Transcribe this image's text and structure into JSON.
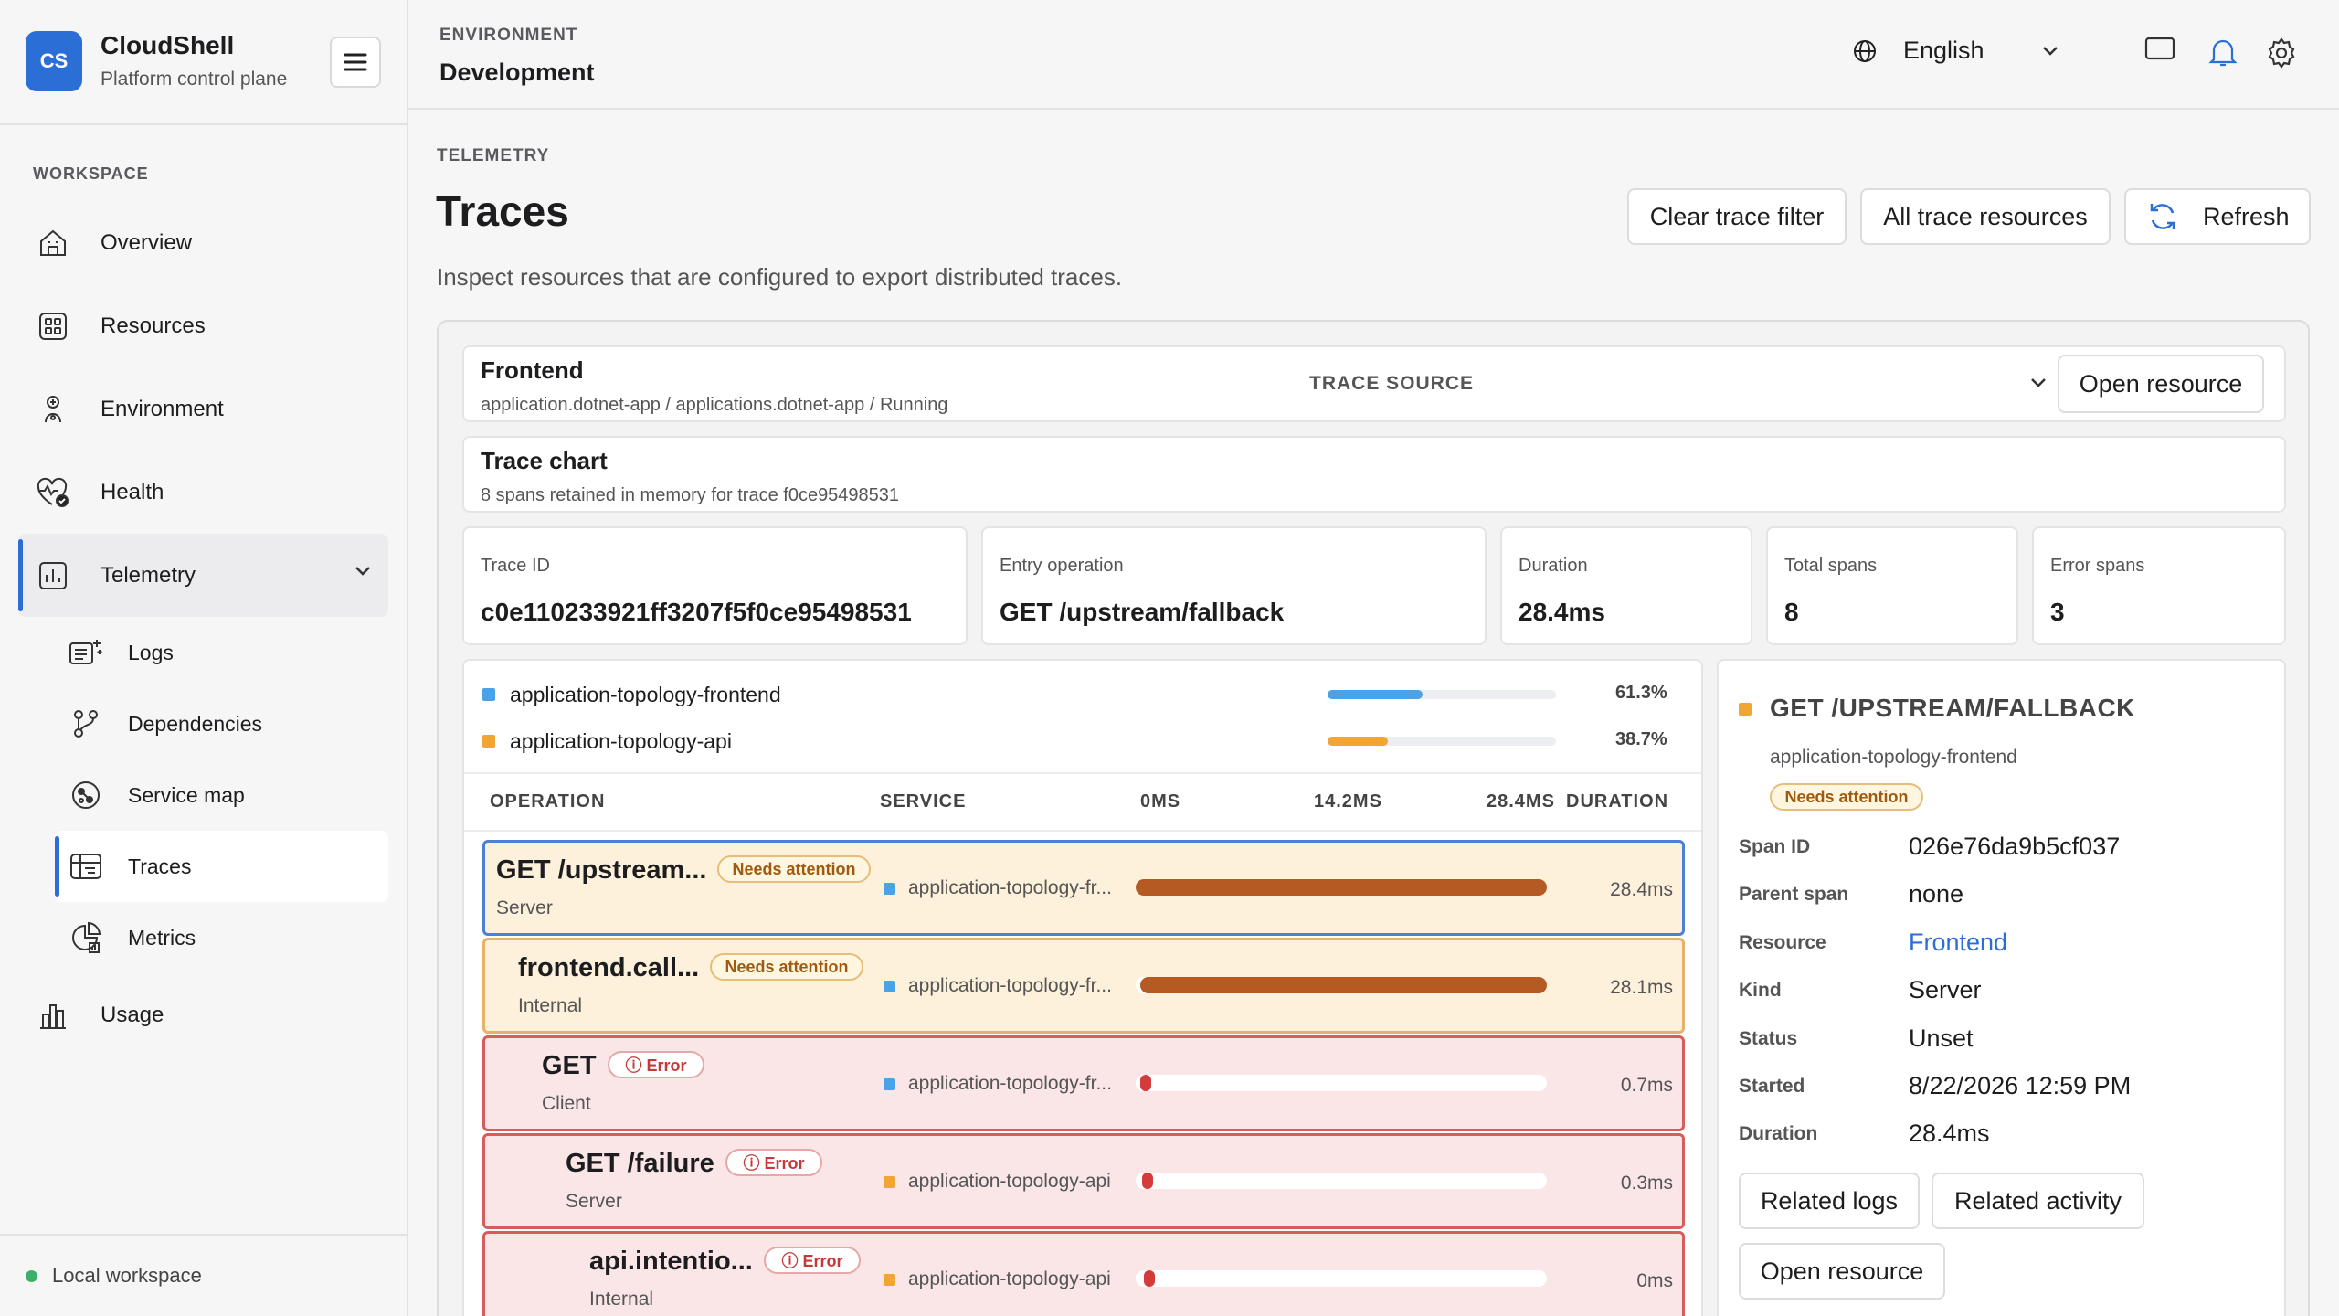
{
  "brand": {
    "logo": "CS",
    "name": "CloudShell",
    "subtitle": "Platform control plane"
  },
  "sidebar": {
    "section_label": "WORKSPACE",
    "items": [
      {
        "label": "Overview",
        "icon": "home-icon"
      },
      {
        "label": "Resources",
        "icon": "grid-icon"
      },
      {
        "label": "Environment",
        "icon": "environment-icon"
      },
      {
        "label": "Health",
        "icon": "heartbeat-icon"
      },
      {
        "label": "Telemetry",
        "icon": "chart-icon",
        "expanded": true
      }
    ],
    "telemetry_children": [
      {
        "label": "Logs",
        "icon": "logs-icon"
      },
      {
        "label": "Dependencies",
        "icon": "dependencies-icon"
      },
      {
        "label": "Service map",
        "icon": "service-map-icon"
      },
      {
        "label": "Traces",
        "icon": "traces-icon",
        "active": true
      },
      {
        "label": "Metrics",
        "icon": "metrics-icon"
      }
    ],
    "usage": {
      "label": "Usage",
      "icon": "usage-icon"
    },
    "footer": "Local workspace"
  },
  "header": {
    "env_label": "ENVIRONMENT",
    "env_value": "Development",
    "language": "English"
  },
  "page": {
    "section_label": "TELEMETRY",
    "title": "Traces",
    "description": "Inspect resources that are configured to export distributed traces.",
    "buttons": {
      "clear": "Clear trace filter",
      "all": "All trace resources",
      "refresh": "Refresh"
    }
  },
  "resource": {
    "name": "Frontend",
    "path": "application.dotnet-app / applications.dotnet-app / Running",
    "trace_source_label": "TRACE SOURCE",
    "open_label": "Open resource"
  },
  "trace_chart": {
    "title": "Trace chart",
    "subtitle": "8 spans retained in memory for trace f0ce95498531"
  },
  "stats": [
    {
      "label": "Trace ID",
      "value": "c0e110233921ff3207f5f0ce95498531"
    },
    {
      "label": "Entry operation",
      "value": "GET /upstream/fallback"
    },
    {
      "label": "Duration",
      "value": "28.4ms"
    },
    {
      "label": "Total spans",
      "value": "8"
    },
    {
      "label": "Error spans",
      "value": "3"
    }
  ],
  "services": [
    {
      "name": "application-topology-frontend",
      "pct_label": "61.3%",
      "share": 0.613,
      "color": "#4aa3e8"
    },
    {
      "name": "application-topology-api",
      "pct_label": "38.7%",
      "share": 0.387,
      "color": "#f0a534"
    }
  ],
  "table": {
    "headers": {
      "operation": "OPERATION",
      "service": "SERVICE",
      "t0": "0MS",
      "t1": "14.2MS",
      "t2": "28.4MS",
      "duration": "DURATION"
    },
    "rows": [
      {
        "op": "GET /upstream...",
        "kind": "Server",
        "badge": "Needs attention",
        "badge_type": "warn",
        "service": "application-topology-fr...",
        "svc_color": "#4aa3e8",
        "start": 0.0,
        "end": 1.0,
        "duration": "28.4ms",
        "indent": 0,
        "status": "selected"
      },
      {
        "op": "frontend.call...",
        "kind": "Internal",
        "badge": "Needs attention",
        "badge_type": "warn",
        "service": "application-topology-fr...",
        "svc_color": "#4aa3e8",
        "start": 0.01,
        "end": 1.0,
        "duration": "28.1ms",
        "indent": 1,
        "status": "warn"
      },
      {
        "op": "GET",
        "kind": "Client",
        "badge": "Error",
        "badge_type": "err",
        "service": "application-topology-fr...",
        "svc_color": "#4aa3e8",
        "start": 0.01,
        "end": 0.035,
        "duration": "0.7ms",
        "indent": 2,
        "status": "err"
      },
      {
        "op": "GET /failure",
        "kind": "Server",
        "badge": "Error",
        "badge_type": "err",
        "service": "application-topology-api",
        "svc_color": "#f0a534",
        "start": 0.015,
        "end": 0.027,
        "duration": "0.3ms",
        "indent": 3,
        "status": "err"
      },
      {
        "op": "api.intentio...",
        "kind": "Internal",
        "badge": "Error",
        "badge_type": "err",
        "service": "application-topology-api",
        "svc_color": "#f0a534",
        "start": 0.02,
        "end": 0.026,
        "duration": "0ms",
        "indent": 4,
        "status": "err"
      }
    ]
  },
  "detail": {
    "title": "GET /UPSTREAM/FALLBACK",
    "service": "application-topology-frontend",
    "badge": "Needs attention",
    "fields": [
      {
        "key": "Span ID",
        "value": "026e76da9b5cf037"
      },
      {
        "key": "Parent span",
        "value": "none"
      },
      {
        "key": "Resource",
        "value": "Frontend",
        "link": true
      },
      {
        "key": "Kind",
        "value": "Server"
      },
      {
        "key": "Status",
        "value": "Unset"
      },
      {
        "key": "Started",
        "value": "8/22/2026 12:59 PM"
      },
      {
        "key": "Duration",
        "value": "28.4ms"
      }
    ],
    "buttons": {
      "logs": "Related logs",
      "activity": "Related activity",
      "open": "Open resource"
    }
  },
  "colors": {
    "accent": "#2a6ed6",
    "warn_bg": "#fdf1dc",
    "warn_border": "#e6b26a",
    "err_bg": "#fae6e6",
    "err_border": "#d75d5d",
    "selected_border": "#4d7fd6",
    "bar_warn": "#b45a22",
    "bar_err": "#d43b3b"
  }
}
